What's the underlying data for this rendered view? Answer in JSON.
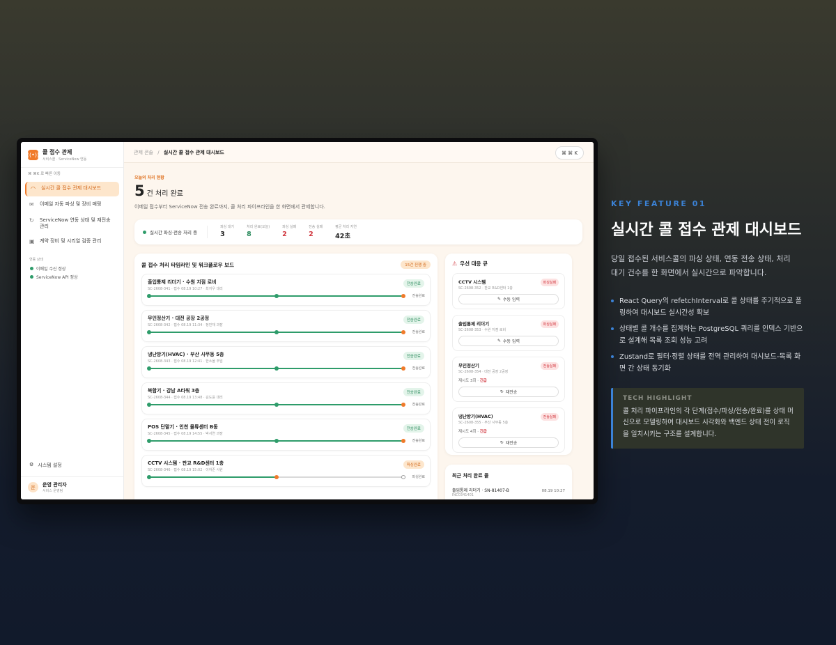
{
  "app": {
    "name": "콜 접수 관제",
    "subtitle": "서비스콜 · ServiceNow 연동",
    "logo_glyph": "((•))"
  },
  "sidebar": {
    "quick_search": "⌘ ⌘K 로 빠른 이동",
    "items": [
      {
        "label": "실시간 콜 접수 관제 대시보드",
        "icon": "gauge-icon",
        "glyph": "◠"
      },
      {
        "label": "이메일 자동 파싱 및 장비 매핑",
        "icon": "mail-icon",
        "glyph": "✉"
      },
      {
        "label": "ServiceNow 연동 상태 및 재전송 관리",
        "icon": "refresh-icon",
        "glyph": "↻"
      },
      {
        "label": "계약 장비 및 시리얼 검증 관리",
        "icon": "device-icon",
        "glyph": "▣"
      }
    ],
    "status_heading": "연동 상태",
    "statuses": [
      "이메일 수신 정상",
      "ServiceNow API 정상"
    ],
    "settings_label": "시스템 설정",
    "user": {
      "initial": "운",
      "name": "운영 관리자",
      "role": "서비스 운영팀"
    }
  },
  "topbar": {
    "crumb_parent": "관제 콘솔",
    "crumb_sep": "/",
    "crumb_current": "실시간 콜 접수 관제 대시보드",
    "shortcut": "⌘ ⌘ K"
  },
  "hero": {
    "eyebrow": "오늘의 처리 현황",
    "count": "5",
    "unit": "건 처리 완료",
    "description": "이메일 접수부터 ServiceNow 전송 완료까지, 콜 처리 파이프라인을 한 화면에서 관제합니다."
  },
  "stats": {
    "live_label": "실시간 파싱·전송 처리 중",
    "items": [
      {
        "label": "파싱 대기",
        "value": "3",
        "color": "#222222"
      },
      {
        "label": "처리 완료(오늘)",
        "value": "8",
        "color": "#2a8a5c"
      },
      {
        "label": "파싱 실패",
        "value": "2",
        "color": "#d0343c"
      },
      {
        "label": "전송 실패",
        "value": "2",
        "color": "#d0343c"
      },
      {
        "label": "평균 처리 지연",
        "value": "42초",
        "color": "#222222"
      }
    ]
  },
  "board": {
    "title": "콜 접수 처리 타임라인 및 워크플로우 보드",
    "badge": "15건 진행 중",
    "calls": [
      {
        "name": "출입통제 리더기 · 수원 지점 로비",
        "sub": "SC-2608-341 · 접수 08.19 10:27 · 최지우 대리",
        "status": "전송완료",
        "kind": "green",
        "progress": 3
      },
      {
        "name": "무인정산기 · 대전 공장 2공정",
        "sub": "SC-2608-342 · 접수 08.19 11:34 · 정민재 과장",
        "status": "전송완료",
        "kind": "green",
        "progress": 3
      },
      {
        "name": "냉난방기(HVAC) · 부산 사무동 5층",
        "sub": "SC-2608-343 · 접수 08.19 12:41 · 한소율 주임",
        "status": "전송완료",
        "kind": "green",
        "progress": 3
      },
      {
        "name": "복합기 · 강남 A타워 3층",
        "sub": "SC-2608-344 · 접수 08.19 13:48 · 김도윤 대리",
        "status": "전송완료",
        "kind": "green",
        "progress": 3
      },
      {
        "name": "POS 단말기 · 인천 물류센터 B동",
        "sub": "SC-2608-345 · 접수 08.19 14:55 · 박서연 과장",
        "status": "전송완료",
        "kind": "green",
        "progress": 3
      },
      {
        "name": "CCTV 시스템 · 판교 R&D센터 1층",
        "sub": "SC-2608-346 · 접수 08.19 15:02 · 이하준 사원",
        "status": "파싱완료",
        "kind": "orange",
        "progress": 2
      }
    ]
  },
  "queue": {
    "title": "우선 대응 큐",
    "items": [
      {
        "name": "CCTV 시스템",
        "sub": "SC-2608-352 · 판교 R&D센터 1층",
        "badge": "파싱실패",
        "retry_prefix": "",
        "retry_urgent": "",
        "button": "수동 입력",
        "button_icon": "edit-icon",
        "button_glyph": "✎"
      },
      {
        "name": "출입통제 리더기",
        "sub": "SC-2608-353 · 수원 지점 로비",
        "badge": "파싱실패",
        "retry_prefix": "",
        "retry_urgent": "",
        "button": "수동 입력",
        "button_icon": "edit-icon",
        "button_glyph": "✎"
      },
      {
        "name": "무인정산기",
        "sub": "SC-2608-354 · 대전 공장 2공정",
        "badge": "전송실패",
        "retry_prefix": "재시도 3회 · ",
        "retry_urgent": "긴급",
        "button": "재전송",
        "button_icon": "refresh-icon",
        "button_glyph": "↻"
      },
      {
        "name": "냉난방기(HVAC)",
        "sub": "SC-2608-355 · 부산 사무동 5층",
        "badge": "전송실패",
        "retry_prefix": "재시도 4회 · ",
        "retry_urgent": "긴급",
        "button": "재전송",
        "button_icon": "refresh-icon",
        "button_glyph": "↻"
      }
    ]
  },
  "recent": {
    "title": "최근 처리 완료 콜",
    "item": {
      "name": "출입통제 리더기 · SN-81407-B",
      "id": "INC0341401",
      "time": "08.19 10:27"
    }
  },
  "feature": {
    "eyebrow": "KEY FEATURE 01",
    "title": "실시간 콜 접수 관제 대시보드",
    "description": "당일 접수된 서비스콜의 파싱 상태, 연동 전송 상태, 처리 대기 건수를 한 화면에서 실시간으로 파악합니다.",
    "bullets": [
      "React Query의 refetchInterval로 콜 상태를 주기적으로 폴링하여 대시보드 실시간성 확보",
      "상태별 콜 개수를 집계하는 PostgreSQL 쿼리를 인덱스 기반으로 설계해 목록 조회 성능 고려",
      "Zustand로 필터·정렬 상태를 전역 관리하여 대시보드-목록 화면 간 상태 동기화"
    ],
    "tech_heading": "TECH HIGHLIGHT",
    "tech_text": "콜 처리 파이프라인의 각 단계(접수/파싱/전송/완료)를 상태 머신으로 모델링하여 대시보드 시각화와 백엔드 상태 전이 로직을 일치시키는 구조를 설계합니다."
  },
  "colors": {
    "accent": "#f07a2a",
    "success": "#2e9c6a",
    "danger": "#d0343c",
    "feature_blue": "#3b82d6"
  }
}
